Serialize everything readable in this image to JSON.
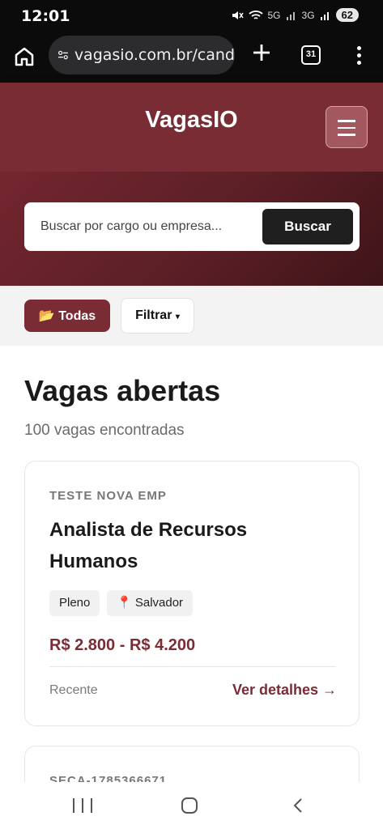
{
  "status_bar": {
    "time": "12:01",
    "signal_labels": [
      "5G",
      "3G"
    ],
    "battery": "62"
  },
  "browser": {
    "url": "vagasio.com.br/cand",
    "tab_count": "31",
    "icons": [
      "home-icon",
      "site-info-icon",
      "plus-icon",
      "tabs-icon",
      "more-vert-icon"
    ]
  },
  "header": {
    "logo": "VagasIO"
  },
  "search": {
    "placeholder": "Buscar por cargo ou empresa...",
    "button_label": "Buscar"
  },
  "filters": {
    "all_label": "📂 Todas",
    "filter_label": "Filtrar",
    "filter_caret": "▾"
  },
  "main": {
    "title": "Vagas abertas",
    "count_text": "100 vagas encontradas"
  },
  "jobs": [
    {
      "company": "TESTE NOVA EMP",
      "title": "Analista de Recursos Humanos",
      "tags": [
        "Pleno",
        "📍 Salvador"
      ],
      "salary": "R$ 2.800 - R$ 4.200",
      "posted": "Recente",
      "details_label": "Ver detalhes →"
    },
    {
      "company": "SECA-1785366671"
    }
  ],
  "colors": {
    "brand": "#7a2c35",
    "brand_dark": "#3e1418",
    "button_dark": "#1f1f1f"
  }
}
